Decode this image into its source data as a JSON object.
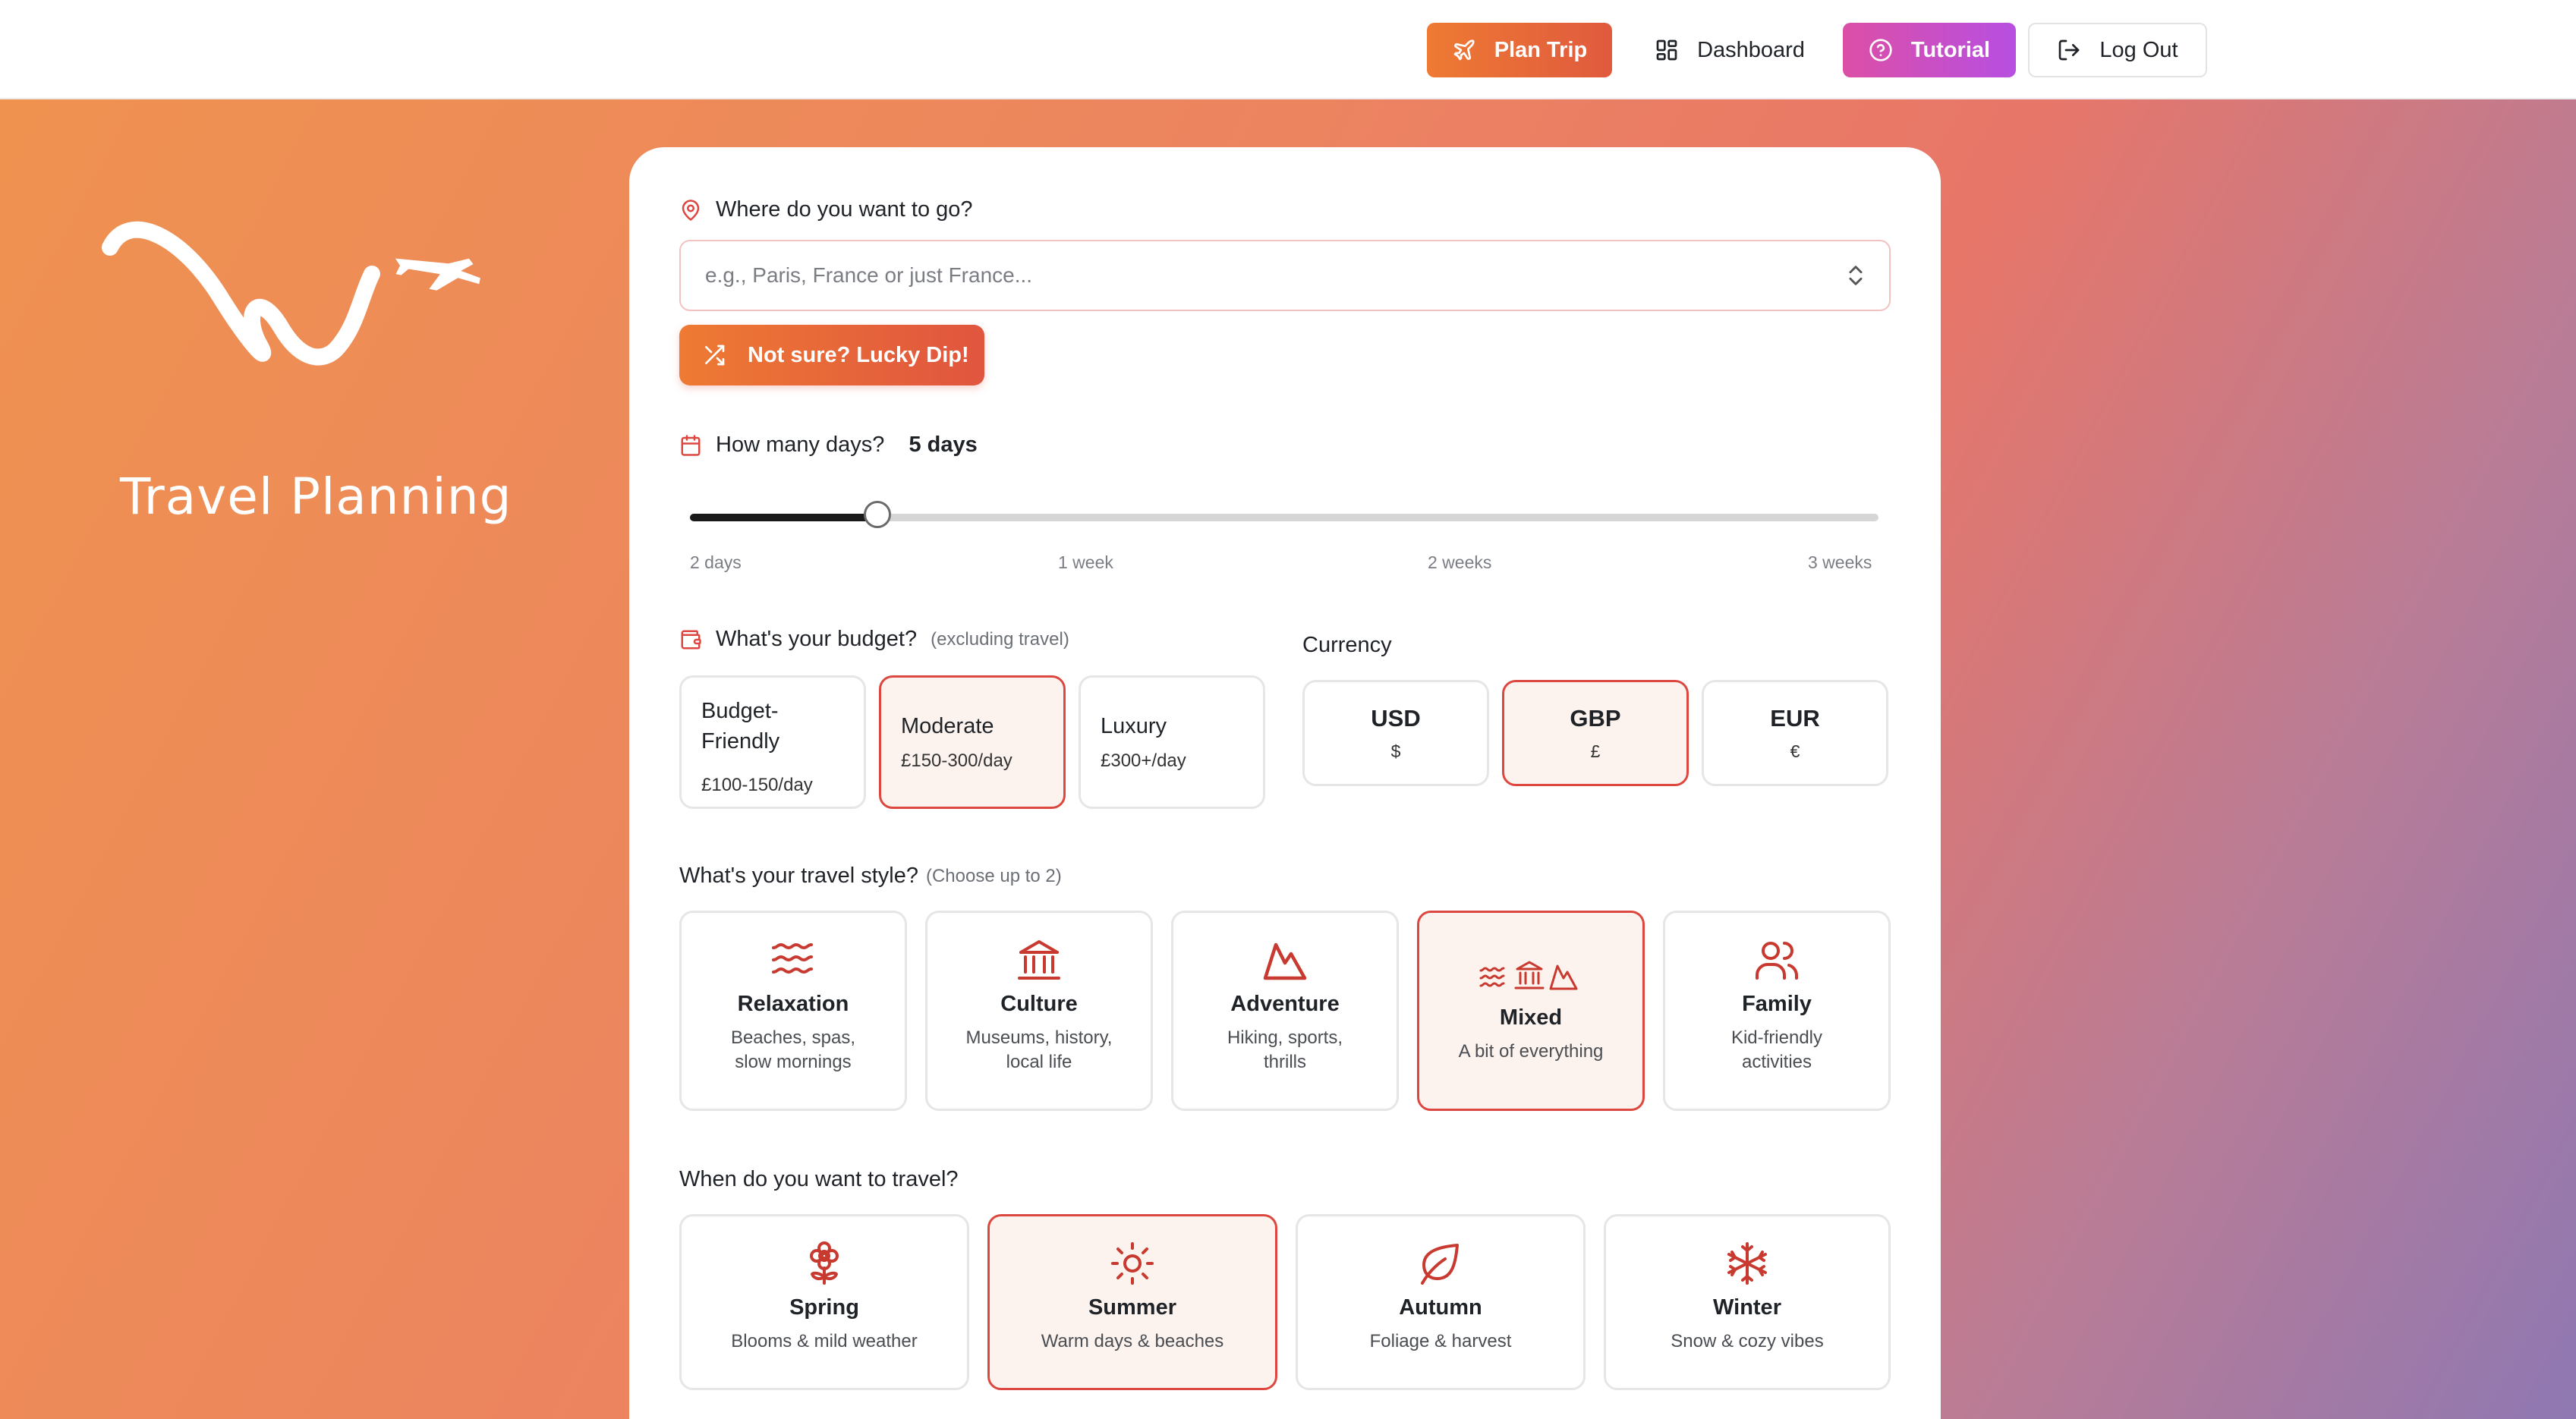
{
  "nav": {
    "plan_trip": "Plan Trip",
    "dashboard": "Dashboard",
    "tutorial": "Tutorial",
    "log_out": "Log Out"
  },
  "brand": {
    "title": "Travel Planning"
  },
  "destination": {
    "label": "Where do you want to go?",
    "placeholder": "e.g., Paris, France or just France...",
    "value": ""
  },
  "lucky_dip": "Not sure? Lucky Dip!",
  "days": {
    "label": "How many days?",
    "value_label": "5 days",
    "value": 5,
    "min": 2,
    "max": 21,
    "ticks": [
      "2 days",
      "1 week",
      "2 weeks",
      "3 weeks"
    ]
  },
  "budget": {
    "label": "What's your budget?",
    "note": "(excluding travel)",
    "options": [
      {
        "title": "Budget-Friendly",
        "sub": "£100-150/day",
        "selected": false
      },
      {
        "title": "Moderate",
        "sub": "£150-300/day",
        "selected": true
      },
      {
        "title": "Luxury",
        "sub": "£300+/day",
        "selected": false
      }
    ]
  },
  "currency": {
    "label": "Currency",
    "options": [
      {
        "code": "USD",
        "symbol": "$",
        "selected": false
      },
      {
        "code": "GBP",
        "symbol": "£",
        "selected": true
      },
      {
        "code": "EUR",
        "symbol": "€",
        "selected": false
      }
    ]
  },
  "travel_style": {
    "label": "What's your travel style?",
    "note": "(Choose up to 2)",
    "options": [
      {
        "title": "Relaxation",
        "sub": "Beaches, spas, slow mornings",
        "icon": "waves-icon",
        "selected": false
      },
      {
        "title": "Culture",
        "sub": "Museums, history, local life",
        "icon": "landmark-icon",
        "selected": false
      },
      {
        "title": "Adventure",
        "sub": "Hiking, sports, thrills",
        "icon": "mountain-icon",
        "selected": false
      },
      {
        "title": "Mixed",
        "sub": "A bit of everything",
        "icon": "mixed-icon",
        "selected": true
      },
      {
        "title": "Family",
        "sub": "Kid-friendly activities",
        "icon": "users-icon",
        "selected": false
      }
    ]
  },
  "season": {
    "label": "When do you want to travel?",
    "options": [
      {
        "title": "Spring",
        "sub": "Blooms & mild weather",
        "icon": "flower-icon",
        "selected": false
      },
      {
        "title": "Summer",
        "sub": "Warm days & beaches",
        "icon": "sun-icon",
        "selected": true
      },
      {
        "title": "Autumn",
        "sub": "Foliage & harvest",
        "icon": "leaf-icon",
        "selected": false
      },
      {
        "title": "Winter",
        "sub": "Snow & cozy vibes",
        "icon": "snowflake-icon",
        "selected": false
      }
    ]
  },
  "colors": {
    "accent_orange": "#ee7a33",
    "accent_red": "#dc4840",
    "tutorial_pink": "#dc4fa6",
    "tutorial_purple": "#b74fe1",
    "icon_red": "#c8392f"
  }
}
